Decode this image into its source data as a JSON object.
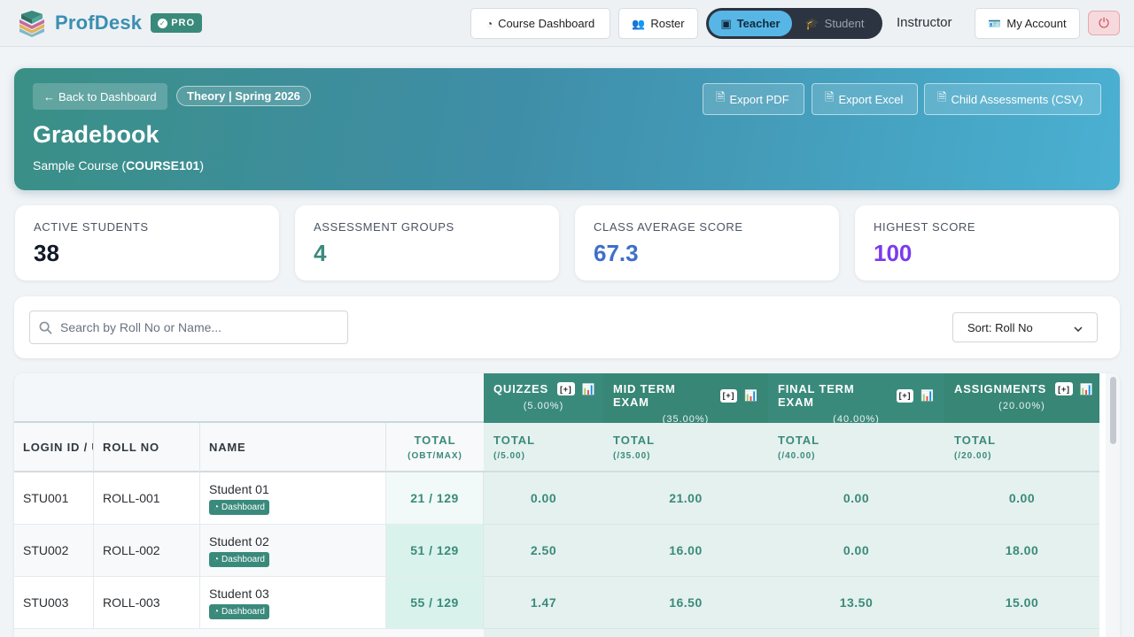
{
  "brand": {
    "name": "ProfDesk",
    "badge": "PRO"
  },
  "nav": {
    "course_dashboard": "Course Dashboard",
    "roster": "Roster",
    "role_teacher": "Teacher",
    "role_student": "Student",
    "user_role": "Instructor",
    "my_account": "My Account"
  },
  "hero": {
    "back_label": "Back to Dashboard",
    "term": "Theory | Spring 2026",
    "title": "Gradebook",
    "course_name": "Sample Course",
    "course_code": "COURSE101",
    "export_pdf": "Export PDF",
    "export_excel": "Export Excel",
    "child_csv": "Child Assessments (CSV)"
  },
  "stats": [
    {
      "label": "ACTIVE STUDENTS",
      "value": "38",
      "color": "#111827"
    },
    {
      "label": "ASSESSMENT GROUPS",
      "value": "4",
      "color": "#3a8a7c"
    },
    {
      "label": "CLASS AVERAGE SCORE",
      "value": "67.3",
      "color": "#3f6fc9"
    },
    {
      "label": "HIGHEST SCORE",
      "value": "100",
      "color": "#7c3aed"
    }
  ],
  "search": {
    "placeholder": "Search by Roll No or Name..."
  },
  "sort": {
    "selected": "Sort: Roll No"
  },
  "table": {
    "columns": {
      "login": "LOGIN ID / USERNAME",
      "roll": "ROLL NO",
      "name": "NAME",
      "total": "TOTAL",
      "total_sub": "(OBT/MAX)"
    },
    "groups": [
      {
        "name": "QUIZZES",
        "weight": "(5.00%)",
        "col_label": "TOTAL",
        "col_sub": "(/5.00)",
        "bg": "#3a8a7c"
      },
      {
        "name": "MID TERM EXAM",
        "weight": "(35.00%)",
        "col_label": "TOTAL",
        "col_sub": "(/35.00)",
        "bg": "#378676"
      },
      {
        "name": "FINAL TERM EXAM",
        "weight": "(40.00%)",
        "col_label": "TOTAL",
        "col_sub": "(/40.00)",
        "bg": "#3a8a7c"
      },
      {
        "name": "ASSIGNMENTS",
        "weight": "(20.00%)",
        "col_label": "TOTAL",
        "col_sub": "(/20.00)",
        "bg": "#378676"
      }
    ],
    "add_label": "[+]",
    "dashboard_badge": "Dashboard",
    "rows": [
      {
        "login": "STU001",
        "roll": "ROLL-001",
        "name": "Student 01",
        "total": "21 / 129",
        "scores": [
          "0.00",
          "21.00",
          "0.00",
          "0.00"
        ]
      },
      {
        "login": "STU002",
        "roll": "ROLL-002",
        "name": "Student 02",
        "total": "51 / 129",
        "scores": [
          "2.50",
          "16.00",
          "0.00",
          "18.00"
        ]
      },
      {
        "login": "STU003",
        "roll": "ROLL-003",
        "name": "Student 03",
        "total": "55 / 129",
        "scores": [
          "1.47",
          "16.50",
          "13.50",
          "15.00"
        ]
      }
    ]
  }
}
